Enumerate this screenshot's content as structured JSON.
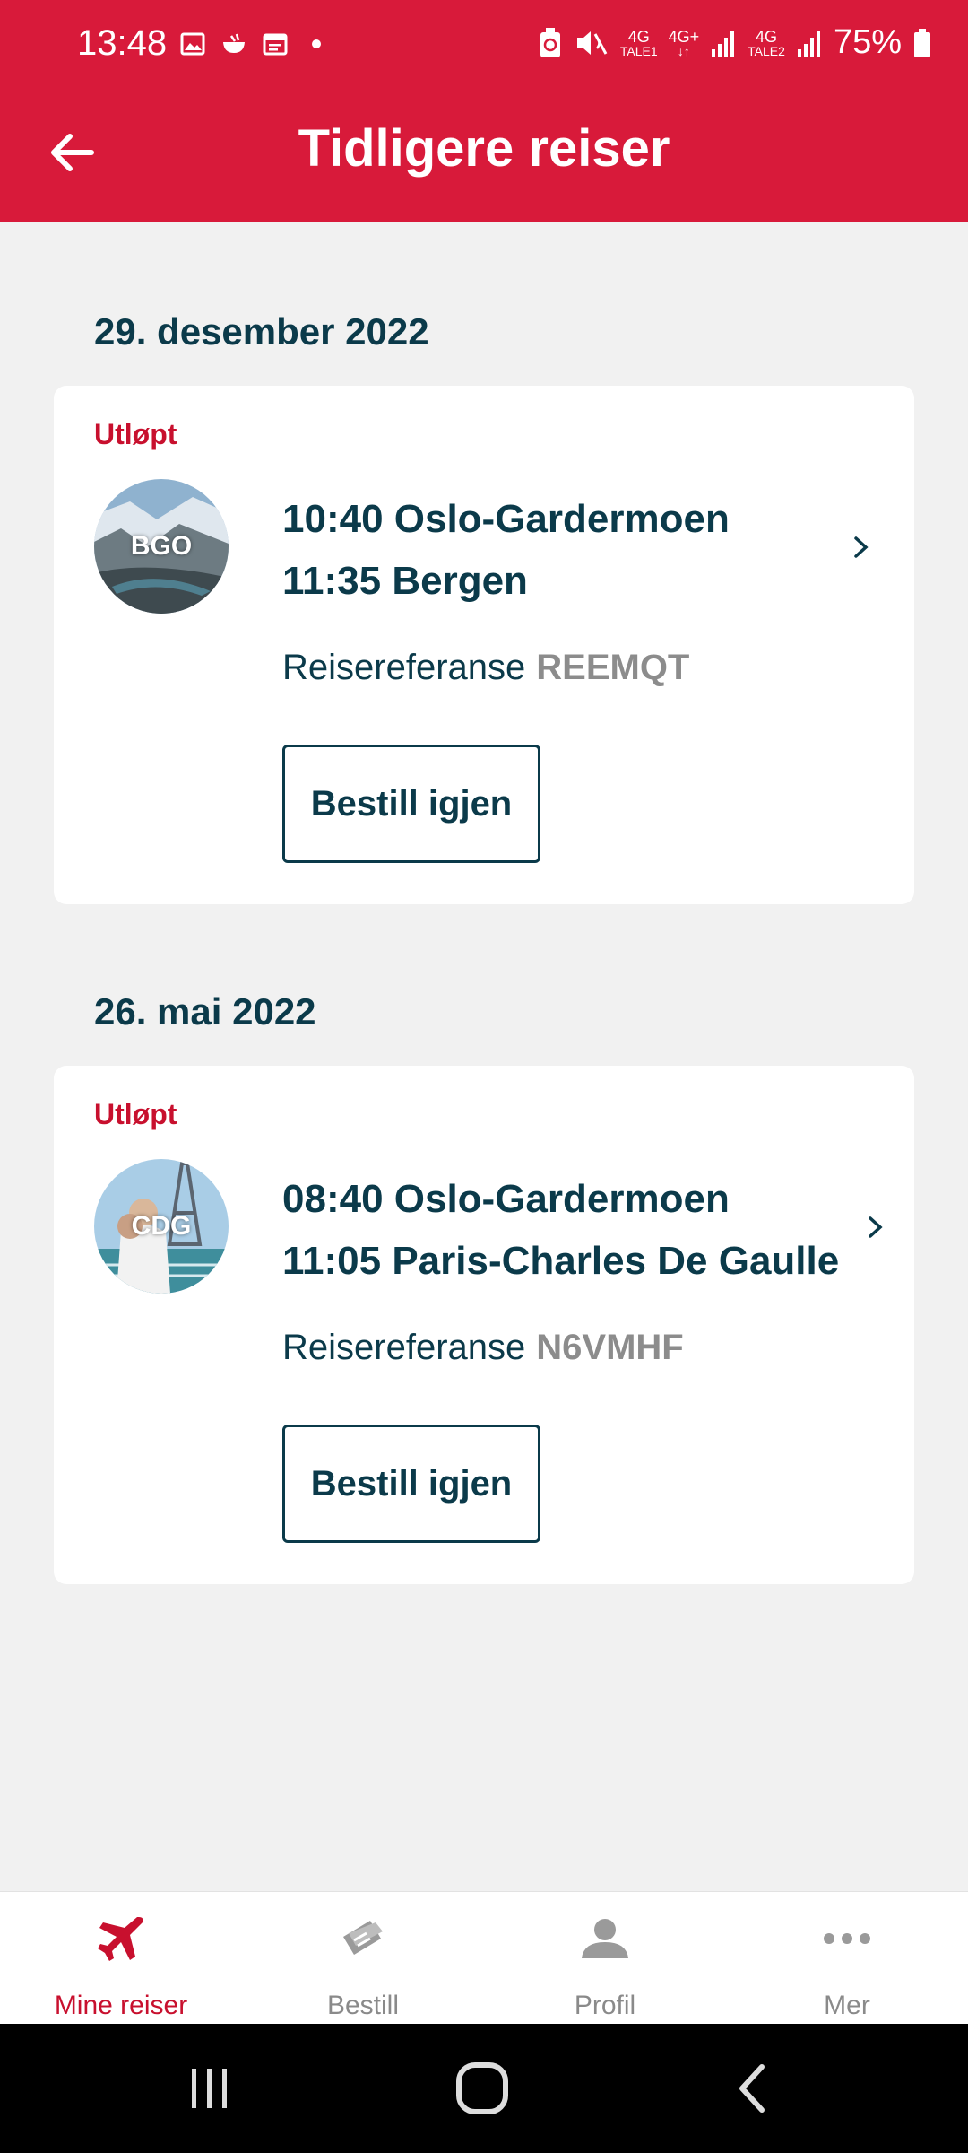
{
  "status_bar": {
    "time": "13:48",
    "battery": "75%",
    "net_label_1": "4G",
    "net_label_2": "4G+",
    "net_label_3": "4G",
    "sim_label_1": "TALE1",
    "sim_label_2": "TALE2"
  },
  "header": {
    "title": "Tidligere reiser"
  },
  "trips": [
    {
      "date": "29. desember 2022",
      "status": "Utløpt",
      "airport_code": "BGO",
      "departure": "10:40 Oslo-Gardermoen",
      "arrival": "11:35 Bergen",
      "ref_label": "Reisereferanse",
      "ref_value": "REEMQT",
      "rebook_label": "Bestill igjen"
    },
    {
      "date": "26. mai 2022",
      "status": "Utløpt",
      "airport_code": "CDG",
      "departure": "08:40 Oslo-Gardermoen",
      "arrival": "11:05 Paris-Charles De Gaulle",
      "ref_label": "Reisereferanse",
      "ref_value": "N6VMHF",
      "rebook_label": "Bestill igjen"
    }
  ],
  "bottom_nav": {
    "items": [
      {
        "label": "Mine reiser",
        "icon": "plane-icon",
        "active": true
      },
      {
        "label": "Bestill",
        "icon": "ticket-icon",
        "active": false
      },
      {
        "label": "Profil",
        "icon": "person-icon",
        "active": false
      },
      {
        "label": "Mer",
        "icon": "more-icon",
        "active": false
      }
    ]
  },
  "colors": {
    "brand_red": "#d81a3a",
    "text_dark": "#0b3a4a",
    "status_red": "#c8102e",
    "muted_gray": "#8c8c8c",
    "background": "#f1f1f1"
  }
}
